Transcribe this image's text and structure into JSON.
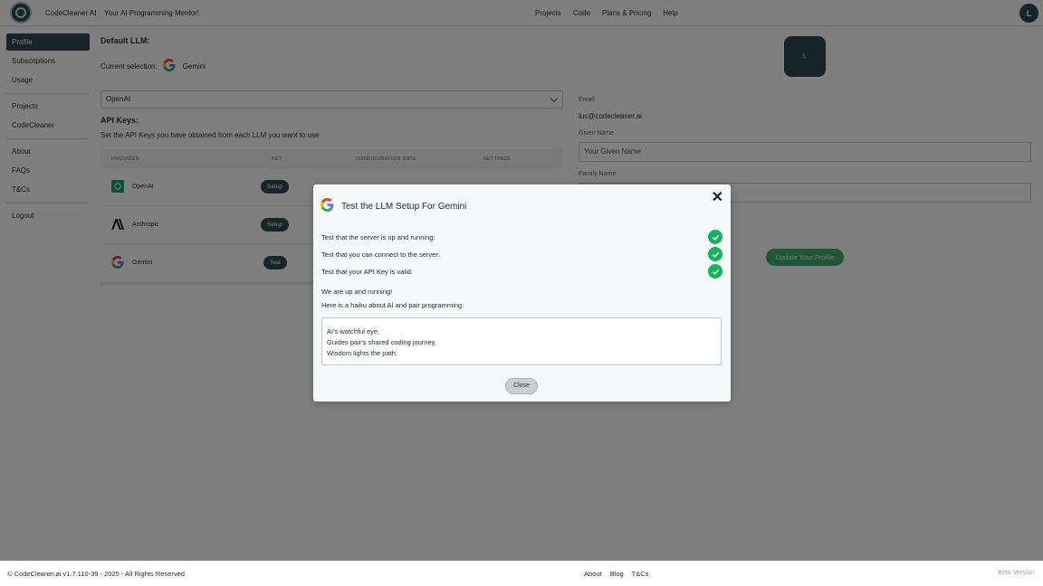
{
  "header": {
    "brand": "CodeCleaner AI",
    "tagline": "Your AI Programming Mentor!",
    "nav": [
      "Projects",
      "Code",
      "Plans & Pricing",
      "Help"
    ],
    "avatar_initial": "L"
  },
  "sidebar": {
    "items": [
      "Profile",
      "Subscriptions",
      "Usage",
      "Projects",
      "CodeCleaner",
      "About",
      "FAQs",
      "T&Cs",
      "Logout"
    ]
  },
  "main": {
    "default_llm_title": "Default LLM:",
    "current_selection_label": "Current selection:",
    "current_selection_value": "Gemini",
    "select_value": "OpenAI",
    "api_keys_title": "API Keys:",
    "api_keys_desc": "Set the API Keys you have obtained from each LLM you want to use",
    "table": {
      "headers": [
        "PROVIDER",
        "KEY",
        "CONFIGURATION DATE",
        "SETTINGS"
      ],
      "rows": [
        {
          "name": "OpenAI",
          "action": "Setup"
        },
        {
          "name": "Anthropic",
          "action": "Setup"
        },
        {
          "name": "Gemini",
          "action": "Test"
        }
      ]
    }
  },
  "profile": {
    "avatar_initial": "L",
    "email_label": "Email",
    "email_value": "luc@codecleaner.ai",
    "given_name_label": "Given Name",
    "given_name_placeholder": "Your Given Name",
    "family_name_label": "Family Name",
    "update_button": "Update Your Profile"
  },
  "modal": {
    "title": "Test the LLM Setup For Gemini",
    "close_x": "✕",
    "checks": [
      "Test that the server is up and running:",
      "Test that you can connect to the server:",
      "Test that your API Key is valid:"
    ],
    "msg1": "We are up and running!",
    "msg2": "Here is a haiku about AI and pair programming:",
    "haiku": [
      "AI's watchful eye,",
      "Guides pair's shared coding journey,",
      "Wisdom lights the path."
    ],
    "close_button": "Close"
  },
  "footer": {
    "copyright": "© CodeCleaner.ai v1.7.110-39 - 2025 - All Rights Reserved",
    "links": [
      "About",
      "Blog",
      "T&Cs"
    ],
    "beta": "Beta Version"
  },
  "colors": {
    "primary": "#2e4a55",
    "success": "#12b558",
    "update_button": "#3fae6f"
  }
}
